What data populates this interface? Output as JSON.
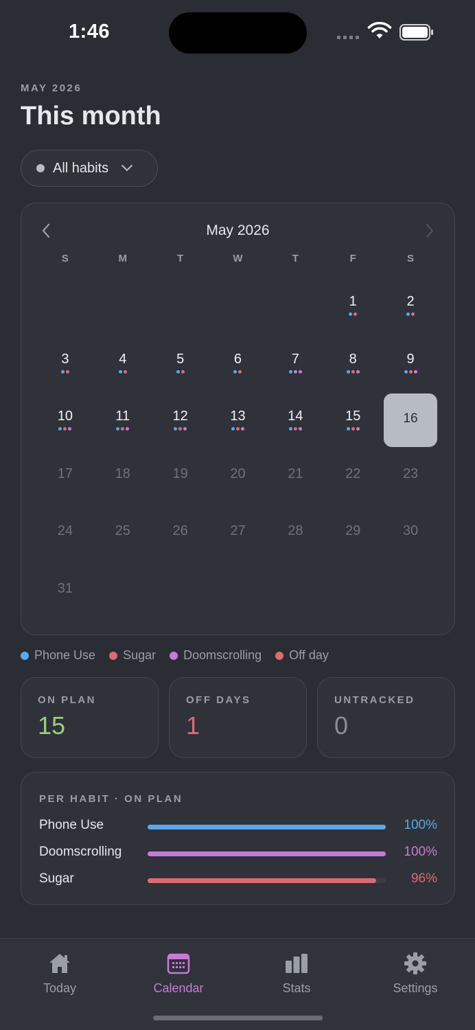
{
  "status": {
    "time": "1:46"
  },
  "header": {
    "month_label": "MAY 2026",
    "title": "This month"
  },
  "filter": {
    "label": "All habits"
  },
  "calendar": {
    "month": "May 2026",
    "weekdays": [
      "S",
      "M",
      "T",
      "W",
      "T",
      "F",
      "S"
    ],
    "leading_blanks": 5,
    "today": 16,
    "days": [
      {
        "n": "1",
        "dots": [
          "blue",
          "red"
        ]
      },
      {
        "n": "2",
        "dots": [
          "blue",
          "red"
        ]
      },
      {
        "n": "3",
        "dots": [
          "blue",
          "red"
        ]
      },
      {
        "n": "4",
        "dots": [
          "blue",
          "red"
        ]
      },
      {
        "n": "5",
        "dots": [
          "blue",
          "red"
        ]
      },
      {
        "n": "6",
        "dots": [
          "blue",
          "red"
        ]
      },
      {
        "n": "7",
        "dots": [
          "blue",
          "purple",
          "purple"
        ]
      },
      {
        "n": "8",
        "dots": [
          "blue",
          "red",
          "purple"
        ]
      },
      {
        "n": "9",
        "dots": [
          "blue",
          "red",
          "purple"
        ]
      },
      {
        "n": "10",
        "dots": [
          "blue",
          "red",
          "purple"
        ]
      },
      {
        "n": "11",
        "dots": [
          "blue",
          "red",
          "purple"
        ]
      },
      {
        "n": "12",
        "dots": [
          "blue",
          "red",
          "purple"
        ]
      },
      {
        "n": "13",
        "dots": [
          "blue",
          "red",
          "purple"
        ]
      },
      {
        "n": "14",
        "dots": [
          "blue",
          "red",
          "purple"
        ]
      },
      {
        "n": "15",
        "dots": [
          "blue",
          "red",
          "purple"
        ]
      },
      {
        "n": "16",
        "dots": []
      },
      {
        "n": "17",
        "dots": []
      },
      {
        "n": "18",
        "dots": []
      },
      {
        "n": "19",
        "dots": []
      },
      {
        "n": "20",
        "dots": []
      },
      {
        "n": "21",
        "dots": []
      },
      {
        "n": "22",
        "dots": []
      },
      {
        "n": "23",
        "dots": []
      },
      {
        "n": "24",
        "dots": []
      },
      {
        "n": "25",
        "dots": []
      },
      {
        "n": "26",
        "dots": []
      },
      {
        "n": "27",
        "dots": []
      },
      {
        "n": "28",
        "dots": []
      },
      {
        "n": "29",
        "dots": []
      },
      {
        "n": "30",
        "dots": []
      },
      {
        "n": "31",
        "dots": []
      }
    ]
  },
  "colors": {
    "blue": "#5aa8ec",
    "red": "#e06a72",
    "purple": "#c77bd6",
    "green": "#9ccf7a",
    "muted": "#8a8e96"
  },
  "legend": [
    {
      "label": "Phone Use",
      "color": "#5aa8ec"
    },
    {
      "label": "Sugar",
      "color": "#e06a72"
    },
    {
      "label": "Doomscrolling",
      "color": "#c77bd6"
    },
    {
      "label": "Off day",
      "color": "#e06a72"
    }
  ],
  "stats": {
    "on_plan": {
      "label": "ON PLAN",
      "value": "15",
      "color": "#9ccf7a"
    },
    "off_days": {
      "label": "OFF DAYS",
      "value": "1",
      "color": "#e06a72"
    },
    "untracked": {
      "label": "UNTRACKED",
      "value": "0",
      "color": "#8a8e96"
    }
  },
  "per_habit": {
    "title": "PER HABIT · ON PLAN",
    "habits": [
      {
        "name": "Phone Use",
        "pct": "100%",
        "fraction": 1.0,
        "color": "#5aa8ec"
      },
      {
        "name": "Doomscrolling",
        "pct": "100%",
        "fraction": 1.0,
        "color": "#c77bd6"
      },
      {
        "name": "Sugar",
        "pct": "96%",
        "fraction": 0.96,
        "color": "#e06a72"
      }
    ]
  },
  "tabs": [
    {
      "label": "Today",
      "icon": "home-icon",
      "active": false
    },
    {
      "label": "Calendar",
      "icon": "calendar-icon",
      "active": true
    },
    {
      "label": "Stats",
      "icon": "bar-chart-icon",
      "active": false
    },
    {
      "label": "Settings",
      "icon": "gear-icon",
      "active": false
    }
  ]
}
